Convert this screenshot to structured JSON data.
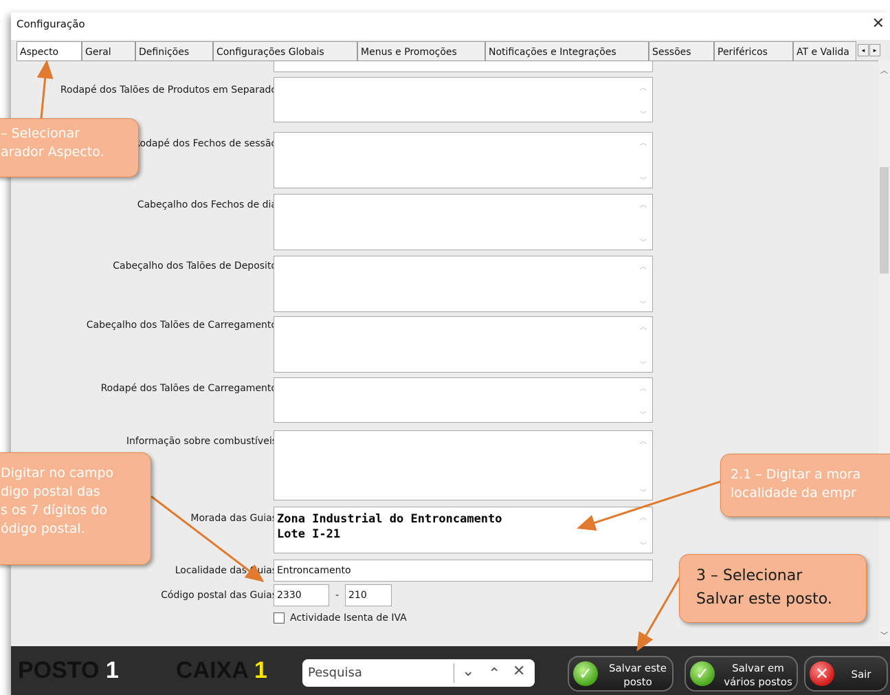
{
  "window": {
    "title": "Configuração",
    "close_symbol": "✕"
  },
  "tabs": [
    {
      "label": "Aspecto",
      "active": true
    },
    {
      "label": "Geral"
    },
    {
      "label": "Definições"
    },
    {
      "label": "Configurações Globais"
    },
    {
      "label": "Menus e Promoções"
    },
    {
      "label": "Notificações e Integrações"
    },
    {
      "label": "Sessões"
    },
    {
      "label": "Periféricos"
    },
    {
      "label": "AT e Valida"
    }
  ],
  "tab_scroll": {
    "left": "◂",
    "right": "▸"
  },
  "form": {
    "fields": [
      {
        "label": "Rodapé dos Talões de Produtos em Separado",
        "value": ""
      },
      {
        "label": "Rodapé dos Fechos de sessão",
        "value": ""
      },
      {
        "label": "Cabeçalho dos Fechos de dia",
        "value": ""
      },
      {
        "label": "Cabeçalho dos Talões de Deposito",
        "value": ""
      },
      {
        "label": "Cabeçalho dos Talões de Carregamento",
        "value": ""
      },
      {
        "label": "Rodapé dos Talões de Carregamento",
        "value": ""
      },
      {
        "label": "Informação sobre combustíveis",
        "value": ""
      },
      {
        "label": "Morada das Guias",
        "value": "Zona Industrial do Entroncamento\nLote I-21"
      }
    ],
    "localidade": {
      "label": "Localidade das Guias",
      "value": "Entroncamento"
    },
    "codigo_postal": {
      "label": "Código postal das Guias",
      "part1": "2330",
      "separator": "-",
      "part2": "210"
    },
    "isento": {
      "label": "Actividade Isenta de IVA",
      "checked": false
    }
  },
  "bottom_bar": {
    "posto_label": "POSTO",
    "posto_num": "1",
    "caixa_label": "CAIXA",
    "caixa_num": "1",
    "search_placeholder": "Pesquisa",
    "save_this": "Salvar este\nposto",
    "save_many": "Salvar em\nvários postos",
    "exit": "Sair"
  },
  "callouts": {
    "c1": "– Selecionar\narador Aspecto.",
    "c2": "Digitar no campo\ndigo postal das\ns os 7 dígitos do\nódigo postal.",
    "c3": "2.1 – Digitar a mora\nlocalidade da empr",
    "c4": "3 – Selecionar\nSalvar este posto."
  },
  "colors": {
    "callout_fill": "#f7b592",
    "arrow": "#e07a2e",
    "bottom_bar": "#2d2d2d",
    "caixa_num": "#ffe600"
  }
}
